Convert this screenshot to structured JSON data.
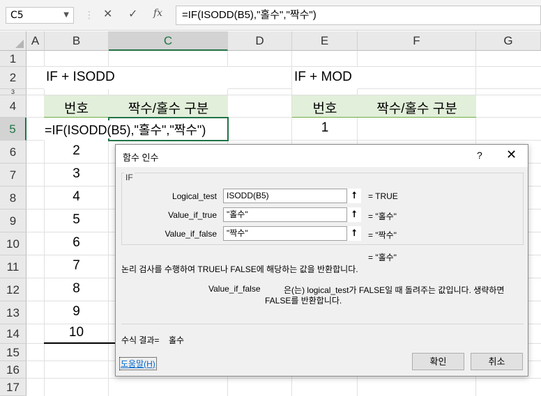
{
  "formula_bar": {
    "name_box": "C5",
    "separator": "⋮",
    "cancel_glyph": "✕",
    "enter_glyph": "✓",
    "fx_label": "fx",
    "formula": "=IF(ISODD(B5),\"홀수\",\"짝수\")"
  },
  "columns": [
    "A",
    "B",
    "C",
    "D",
    "E",
    "F",
    "G"
  ],
  "rows": [
    "1",
    "2",
    "3",
    "4",
    "5",
    "6",
    "7",
    "8",
    "9",
    "10",
    "11",
    "12",
    "13",
    "14",
    "15",
    "16",
    "17"
  ],
  "sheet": {
    "b2": "IF + ISODD",
    "e2": "IF + MOD",
    "b4": "번호",
    "c4": "짝수/홀수 구분",
    "e4": "번호",
    "f4": "짝수/홀수 구분",
    "b5_formula": "=IF(ISODD(B5),\"홀수\",\"짝수\")",
    "e5": "1",
    "b_values": [
      "2",
      "3",
      "4",
      "5",
      "6",
      "7",
      "8",
      "9",
      "10"
    ]
  },
  "dialog": {
    "title": "함수 인수",
    "help_glyph": "?",
    "close_glyph": "✕",
    "function_name": "IF",
    "args": [
      {
        "label": "Logical_test",
        "value": "ISODD(B5)",
        "result": "=  TRUE"
      },
      {
        "label": "Value_if_true",
        "value": "\"홀수\"",
        "result": "=  \"홀수\""
      },
      {
        "label": "Value_if_false",
        "value": "\"짝수\"",
        "result": "=  \"짝수\""
      }
    ],
    "collapse_glyph": "⭡",
    "overall_result": "=  \"홀수\"",
    "description": "논리 검사를 수행하여 TRUE나 FALSE에 해당하는 값을 반환합니다.",
    "arg_name": "Value_if_false",
    "arg_desc_line1": "은(는) logical_test가 FALSE일 때 돌려주는 값입니다. 생략하면",
    "arg_desc_line2": "FALSE를 반환합니다.",
    "formula_result_label": "수식 결과=",
    "formula_result_value": "홀수",
    "help_link": "도움말(H)",
    "ok_label": "확인",
    "cancel_label": "취소"
  }
}
